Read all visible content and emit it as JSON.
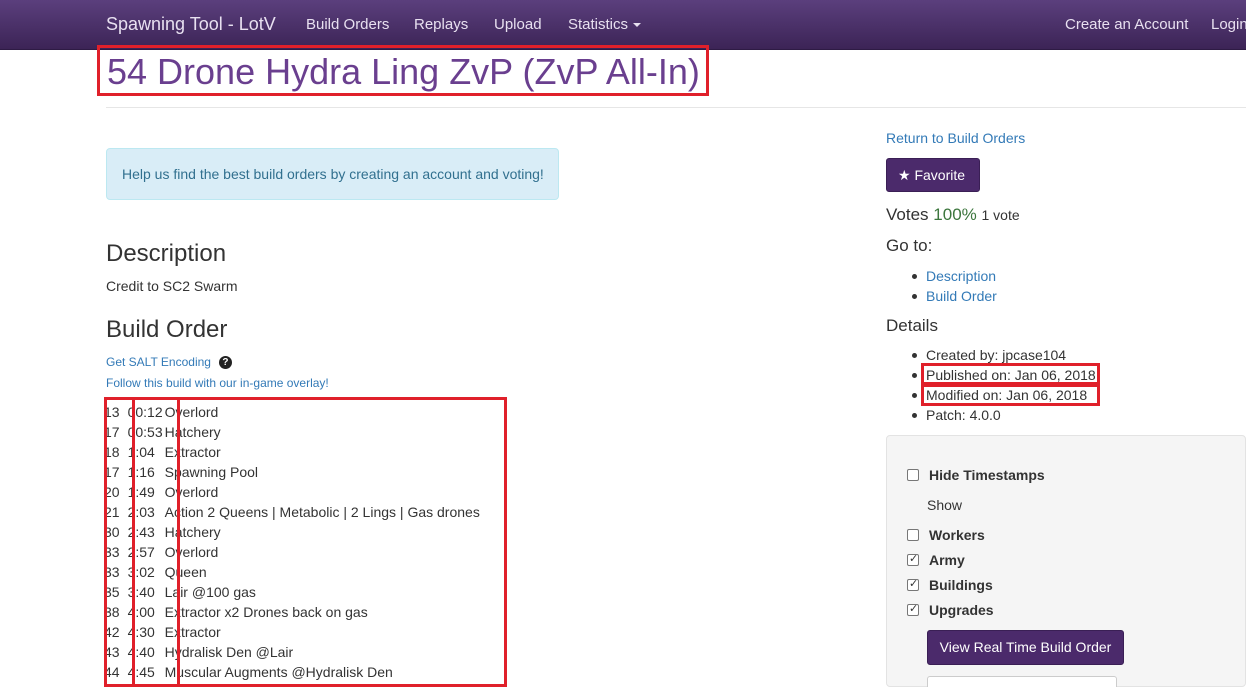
{
  "navbar": {
    "brand": "Spawning Tool - LotV",
    "build_orders": "Build Orders",
    "replays": "Replays",
    "upload": "Upload",
    "statistics": "Statistics",
    "create_account": "Create an Account",
    "login": "Login"
  },
  "page": {
    "title": "54 Drone Hydra Ling ZvP (ZvP All-In)",
    "alert": "Help us find the best build orders by creating an account and voting!",
    "description_heading": "Description",
    "description_text": "Credit to SC2 Swarm",
    "build_heading": "Build Order",
    "salt_link": "Get SALT Encoding",
    "help_icon": "?",
    "overlay_link": "Follow this build with our in-game overlay!"
  },
  "build_order": [
    {
      "supply": "13",
      "time": "00:12",
      "action": "Overlord"
    },
    {
      "supply": "17",
      "time": "00:53",
      "action": "Hatchery"
    },
    {
      "supply": "18",
      "time": "1:04",
      "action": "Extractor"
    },
    {
      "supply": "17",
      "time": "1:16",
      "action": "Spawning Pool"
    },
    {
      "supply": "20",
      "time": "1:49",
      "action": "Overlord"
    },
    {
      "supply": "21",
      "time": "2:03",
      "action": "Action 2 Queens | Metabolic | 2 Lings | Gas drones"
    },
    {
      "supply": "30",
      "time": "2:43",
      "action": "Hatchery"
    },
    {
      "supply": "33",
      "time": "2:57",
      "action": "Overlord"
    },
    {
      "supply": "33",
      "time": "3:02",
      "action": "Queen"
    },
    {
      "supply": "35",
      "time": "3:40",
      "action": "Lair @100 gas"
    },
    {
      "supply": "38",
      "time": "4:00",
      "action": "Extractor x2 Drones back on gas"
    },
    {
      "supply": "42",
      "time": "4:30",
      "action": "Extractor"
    },
    {
      "supply": "43",
      "time": "4:40",
      "action": "Hydralisk Den @Lair"
    },
    {
      "supply": "44",
      "time": "4:45",
      "action": "Muscular Augments @Hydralisk Den"
    }
  ],
  "sidebar": {
    "return_link": "Return to Build Orders",
    "favorite_star": "★",
    "favorite": "Favorite",
    "votes_label": "Votes",
    "votes_pct": "100%",
    "votes_count": "1 vote",
    "goto_heading": "Go to:",
    "goto_description": "Description",
    "goto_build": "Build Order",
    "details_heading": "Details",
    "created_by": "Created by: jpcase104",
    "published_on": "Published on: Jan 06, 2018",
    "modified_on": "Modified on: Jan 06, 2018",
    "patch": "Patch: 4.0.0"
  },
  "options": {
    "hide_timestamps": "Hide Timestamps",
    "hide_timestamps_checked": false,
    "show_label": "Show",
    "workers": "Workers",
    "workers_checked": false,
    "army": "Army",
    "army_checked": true,
    "buildings": "Buildings",
    "buildings_checked": true,
    "upgrades": "Upgrades",
    "upgrades_checked": true,
    "realtime_button": "View Real Time Build Order"
  },
  "colors": {
    "nav_bg": "#4a2f69",
    "title": "#6a3f8f",
    "button": "#4b2a6b",
    "highlight_box": "#e0202a",
    "link": "#337ab7"
  }
}
